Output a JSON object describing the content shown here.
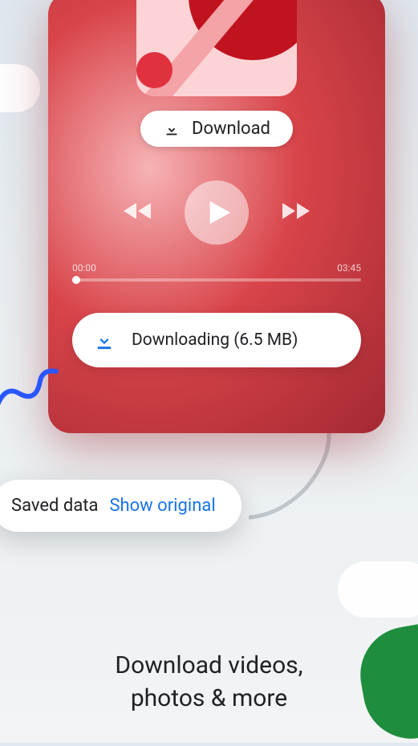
{
  "download_button_label": "Download",
  "player": {
    "current_time": "00:00",
    "total_time": "03:45"
  },
  "downloading_status": "Downloading (6.5 MB)",
  "saved_data": {
    "label": "Saved data",
    "link": "Show original"
  },
  "headline_line1": "Download videos,",
  "headline_line2": "photos & more",
  "colors": {
    "accent_blue": "#1a73e8",
    "green": "#1e8e3e",
    "red": "#c0131f"
  }
}
